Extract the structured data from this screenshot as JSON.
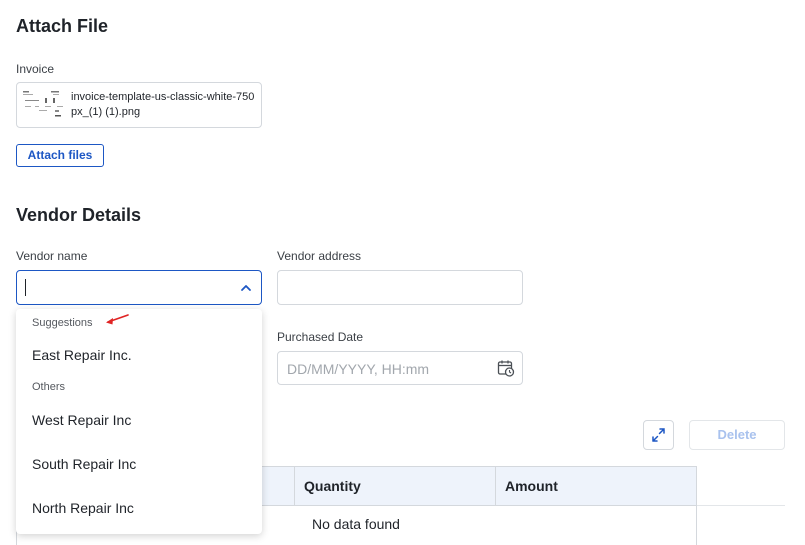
{
  "attach_section": {
    "title": "Attach File",
    "invoice_label": "Invoice",
    "file_name": "invoice-template-us-classic-white-750px_(1) (1).png",
    "attach_button": "Attach files"
  },
  "vendor_section": {
    "title": "Vendor Details",
    "vendor_name_label": "Vendor name",
    "vendor_name_value": "",
    "vendor_address_label": "Vendor address",
    "vendor_address_value": "",
    "purchased_date_label": "Purchased Date",
    "purchased_date_placeholder": "DD/MM/YYYY, HH:mm"
  },
  "dropdown": {
    "suggestions_label": "Suggestions",
    "suggestions": [
      "East Repair Inc."
    ],
    "others_label": "Others",
    "others": [
      "West Repair Inc",
      "South Repair Inc",
      "North Repair Inc"
    ]
  },
  "table": {
    "delete_button": "Delete",
    "columns": [
      "Quantity",
      "Amount"
    ],
    "empty_text": "No data found"
  },
  "colors": {
    "accent": "#1d57c4",
    "annotation_arrow": "#e02424",
    "table_header_bg": "#eef3fb"
  },
  "icons": [
    "chevron-up-icon",
    "calendar-clock-icon",
    "expand-icon",
    "red-arrow-annotation"
  ]
}
